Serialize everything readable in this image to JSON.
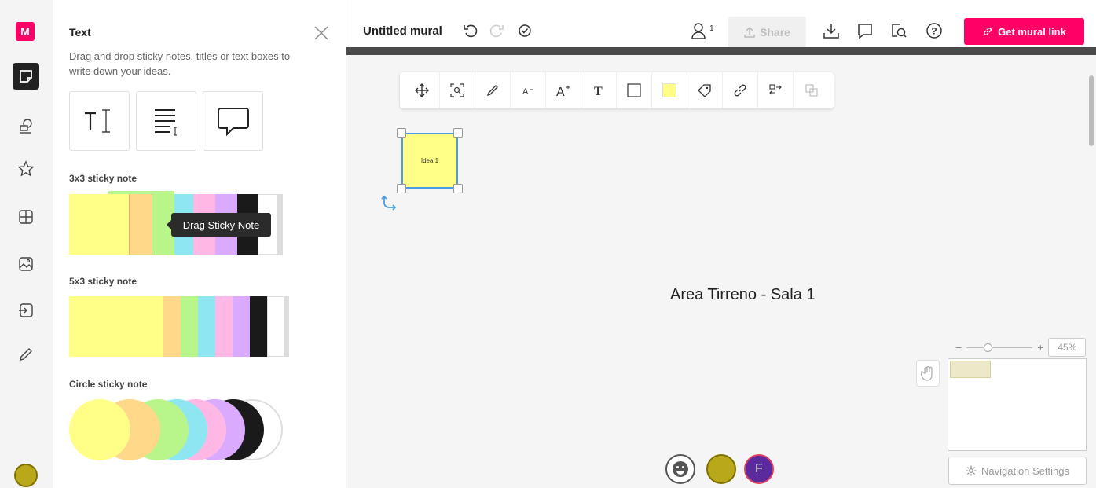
{
  "rail": {
    "logo": "M",
    "items": [
      "sticky-note",
      "shapes",
      "favorites",
      "frameworks",
      "images",
      "import",
      "draw"
    ]
  },
  "panel": {
    "title": "Text",
    "description": "Drag and drop sticky notes, titles or text boxes to write down your ideas.",
    "tools": [
      "title-text",
      "text-box",
      "comment-bubble"
    ],
    "sections": {
      "sticky_3x3": "3x3 sticky note",
      "sticky_5x3": "5x3 sticky note",
      "circle": "Circle sticky note"
    },
    "tooltip": "Drag Sticky Note",
    "colors": [
      "#ffff88",
      "#ffd88a",
      "#b8f58a",
      "#8ee6f2",
      "#ffb8e6",
      "#d9aaff",
      "#1a1a1a",
      "#ffffff"
    ]
  },
  "topbar": {
    "title": "Untitled mural",
    "user_count": "1",
    "share_label": "Share",
    "get_link_label": "Get mural link",
    "brand_color": "#ff0066"
  },
  "canvas": {
    "sticky_text": "Idea 1",
    "area_label": "Area Tirreno - Sala 1",
    "zoom_minus": "−",
    "zoom_plus": "+",
    "zoom_pct": "45%",
    "nav_settings_label": "Navigation Settings",
    "avatar_initial": "F"
  }
}
